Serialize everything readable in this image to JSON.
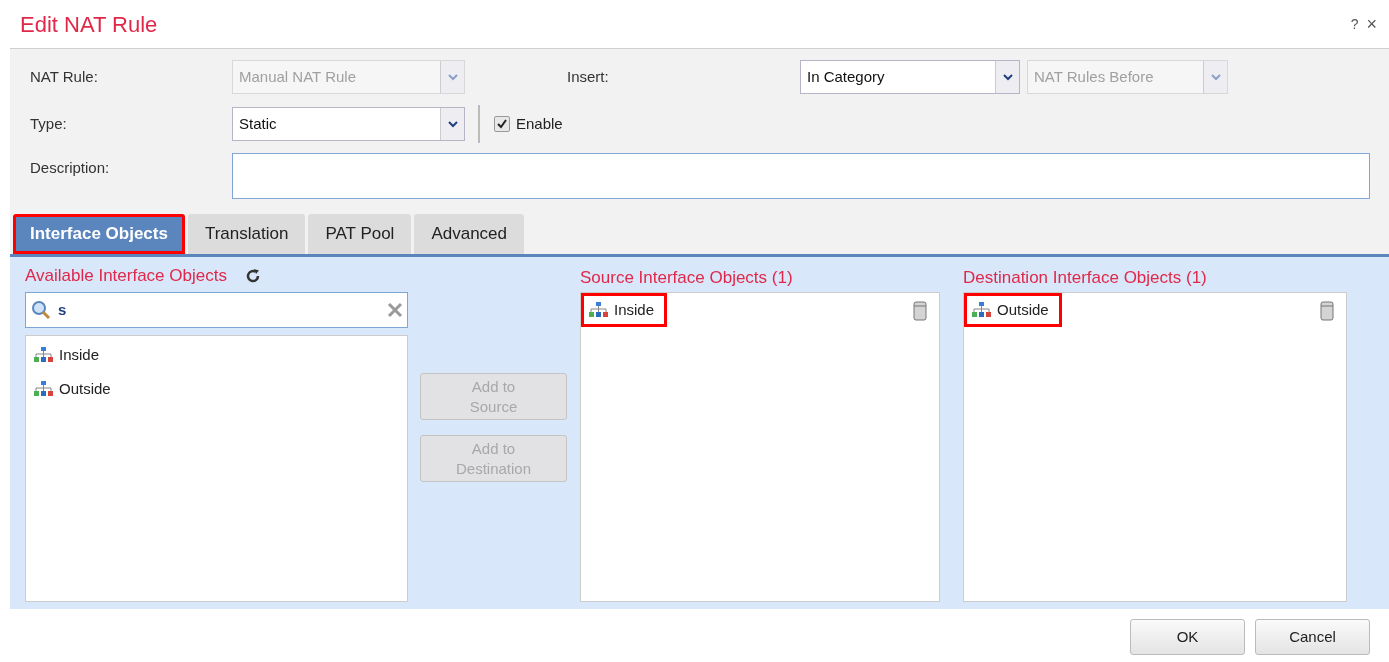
{
  "dialog": {
    "title": "Edit NAT Rule",
    "help": "?",
    "close": "×"
  },
  "form": {
    "nat_rule": {
      "label": "NAT Rule:",
      "value": "Manual NAT Rule",
      "disabled": true
    },
    "insert": {
      "label": "Insert:",
      "value": "In Category",
      "disabled": false
    },
    "insert_position": {
      "value": "NAT Rules Before",
      "disabled": true
    },
    "type": {
      "label": "Type:",
      "value": "Static",
      "disabled": false
    },
    "enable": {
      "label": "Enable",
      "checked": true
    },
    "description": {
      "label": "Description:"
    }
  },
  "tabs": [
    {
      "label": "Interface Objects",
      "selected": true,
      "highlighted": true
    },
    {
      "label": "Translation",
      "selected": false,
      "highlighted": false
    },
    {
      "label": "PAT Pool",
      "selected": false,
      "highlighted": false
    },
    {
      "label": "Advanced",
      "selected": false,
      "highlighted": false
    }
  ],
  "available": {
    "title": "Available Interface Objects",
    "search": {
      "value": "s"
    },
    "items": [
      {
        "label": "Inside"
      },
      {
        "label": "Outside"
      }
    ]
  },
  "add_buttons": [
    {
      "label": "Add to Source",
      "disabled": true
    },
    {
      "label": "Add to Destination",
      "disabled": true
    }
  ],
  "source": {
    "title": "Source Interface Objects (1)",
    "items": [
      {
        "label": "Inside",
        "highlighted": true
      }
    ]
  },
  "destination": {
    "title": "Destination Interface Objects (1)",
    "items": [
      {
        "label": "Outside",
        "highlighted": true
      }
    ]
  },
  "footer": {
    "buttons": [
      "OK",
      "Cancel"
    ]
  }
}
